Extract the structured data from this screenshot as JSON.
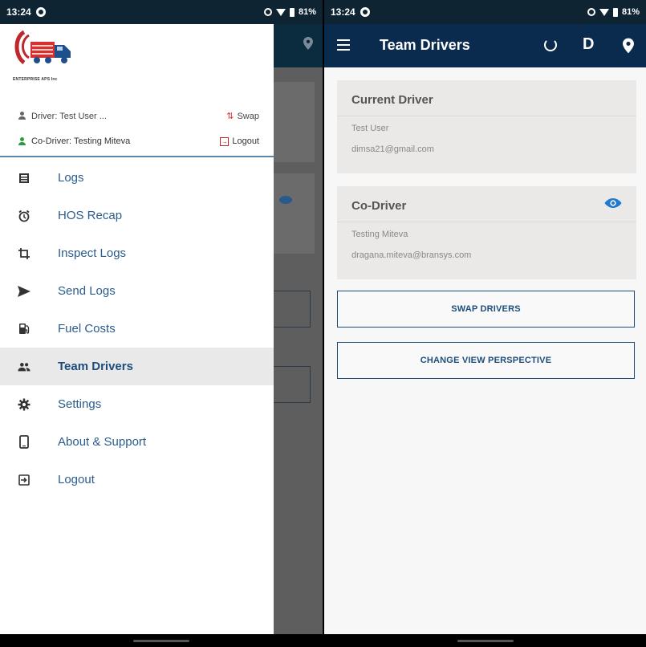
{
  "status_bar": {
    "time": "13:24",
    "battery": "81%"
  },
  "drawer": {
    "company_name": "ENTERPRISE APS Inc",
    "driver_label": "Driver: Test User ...",
    "co_driver_label": "Co-Driver: Testing Miteva",
    "swap_label": "Swap",
    "logout_label": "Logout",
    "menu": [
      {
        "label": "Logs",
        "icon": "logs-icon"
      },
      {
        "label": "HOS Recap",
        "icon": "alarm-clock-icon"
      },
      {
        "label": "Inspect Logs",
        "icon": "crop-icon"
      },
      {
        "label": "Send Logs",
        "icon": "send-icon"
      },
      {
        "label": "Fuel Costs",
        "icon": "fuel-pump-icon"
      },
      {
        "label": "Team Drivers",
        "icon": "group-icon",
        "active": true
      },
      {
        "label": "Settings",
        "icon": "gear-icon"
      },
      {
        "label": "About & Support",
        "icon": "phone-icon"
      },
      {
        "label": "Logout",
        "icon": "logout-icon"
      }
    ]
  },
  "toolbar": {
    "title": "Team Drivers",
    "user_initial": "D"
  },
  "current_driver": {
    "title": "Current Driver",
    "name": "Test User",
    "email": "dimsa21@gmail.com"
  },
  "co_driver": {
    "title": "Co-Driver",
    "name": "Testing Miteva",
    "email": "dragana.miteva@bransys.com"
  },
  "buttons": {
    "swap": "SWAP DRIVERS",
    "change_view": "CHANGE VIEW PERSPECTIVE"
  },
  "colors": {
    "toolbar": "#0b2b4e",
    "status_bar": "#0e2433",
    "accent": "#1e4d7c",
    "menu_text": "#2b5c8c",
    "eye_icon": "#1f7ad1"
  }
}
